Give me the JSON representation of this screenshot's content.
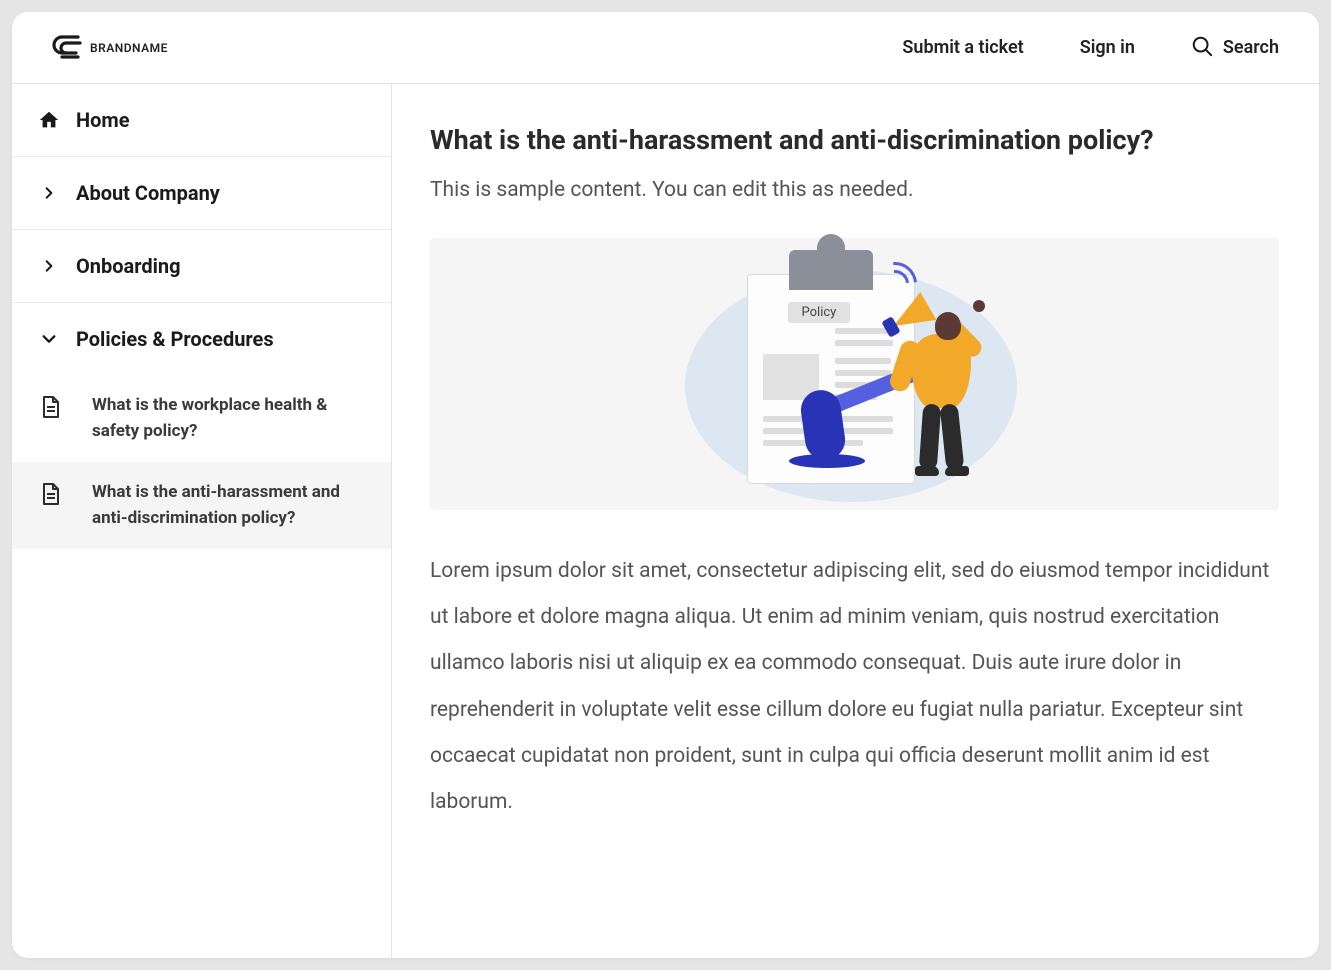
{
  "brand": {
    "name": "BRANDNAME"
  },
  "header": {
    "submit_ticket": "Submit a ticket",
    "sign_in": "Sign in",
    "search": "Search"
  },
  "sidebar": {
    "home": "Home",
    "about_company": "About Company",
    "onboarding": "Onboarding",
    "policies_procedures": "Policies & Procedures",
    "sub": [
      {
        "label": "What is the workplace health & safety policy?",
        "active": false
      },
      {
        "label": "What is the anti-harassment and anti-discrimination policy?",
        "active": true
      }
    ]
  },
  "article": {
    "title": "What is the anti-harassment and anti-discrimination policy?",
    "intro": "This is sample content. You can edit this as needed.",
    "image_badge": "Policy",
    "body": "Lorem ipsum dolor sit amet, consectetur adipiscing elit, sed do eiusmod tempor incididunt ut labore et dolore magna aliqua. Ut enim ad minim veniam, quis nostrud exercitation ullamco laboris nisi ut aliquip ex ea commodo consequat. Duis aute irure dolor in reprehenderit in voluptate velit esse cillum dolore eu fugiat nulla pariatur. Excepteur sint occaecat cupidatat non proident, sunt in culpa qui officia deserunt mollit anim id est laborum."
  }
}
